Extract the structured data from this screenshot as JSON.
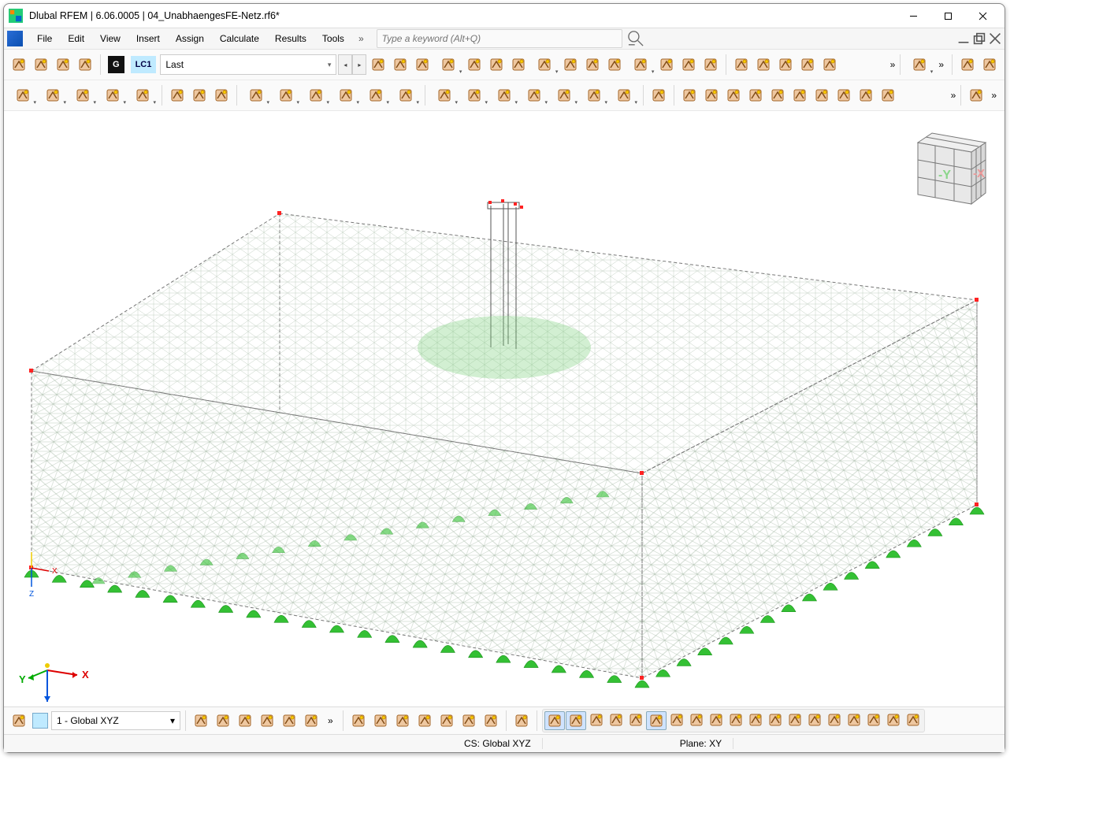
{
  "title": "Dlubal RFEM | 6.06.0005 | 04_UnabhaengesFE-Netz.rf6*",
  "menu": {
    "file": "File",
    "edit": "Edit",
    "view": "View",
    "insert": "Insert",
    "assign": "Assign",
    "calculate": "Calculate",
    "results": "Results",
    "tools": "Tools"
  },
  "search": {
    "placeholder": "Type a keyword (Alt+Q)"
  },
  "loadcase": {
    "tag_g": "G",
    "tag_lc": "LC1",
    "combo": "Last"
  },
  "coordinate_system": {
    "combo": "1 - Global XYZ"
  },
  "status": {
    "cs": "CS: Global XYZ",
    "plane": "Plane: XY"
  },
  "viewcube": {
    "x": "-X",
    "y": "-Y"
  },
  "axes": {
    "x": "X",
    "y": "Y",
    "z": "Z"
  },
  "toolbar1_icons": [
    "align-top",
    "align-bottom",
    "color-swatch-1",
    "color-swatch-2"
  ],
  "toolbar1b_icons": [
    "prev-load",
    "next-load",
    "run-solve",
    "show-deformation",
    "show-loads",
    "show-hide",
    "results-values",
    "results-format",
    "view-eye-1",
    "view-eye-2",
    "view-toggle",
    "view-eye-3",
    "section-view",
    "mesh-settings",
    "mesh-options"
  ],
  "toolbar1c_icons": [
    "new-model",
    "open-model",
    "cloud-1",
    "cloud-2",
    "snapshot"
  ],
  "toolbar1d_icons": [
    "select-arrow"
  ],
  "toolbar1e_icons": [
    "zoom-find",
    "zoom-previous"
  ],
  "toolbar2a_icons": [
    "new-node",
    "new-line",
    "new-member",
    "new-surface",
    "new-solid"
  ],
  "toolbar2b_icons": [
    "support-1",
    "support-2",
    "support-3"
  ],
  "toolbar2c_icons": [
    "load-node",
    "load-line",
    "load-area",
    "load-temp",
    "load-free",
    "load-options"
  ],
  "toolbar2d_icons": [
    "select-special",
    "grid-select",
    "select-line",
    "select-member",
    "copy-special",
    "array",
    "mirror"
  ],
  "toolbar2e_icons": [
    "dimension"
  ],
  "toolbar2f_icons": [
    "filter",
    "ortho",
    "frame-view",
    "section",
    "extrude",
    "wall",
    "cube-view",
    "grid-mesh",
    "line-mesh",
    "check"
  ],
  "toolbar2g_icons": [
    "grid-toggle"
  ],
  "bottombar_left": [
    "workplane",
    "move-wp",
    "rotate-wp",
    "offset-wp",
    "flip-wp",
    "grid-wp",
    "star-wp"
  ],
  "bottombar_mid": [
    "vis-1",
    "vis-2",
    "vis-3",
    "vis-4",
    "vis-5",
    "vis-6",
    "vis-7"
  ],
  "bottombar_snap": [
    "snap-grid",
    "snap-magnet",
    "snap-end",
    "snap-mid",
    "snap-int",
    "snap-perp",
    "snap-tan",
    "snap-par",
    "snap-circle",
    "snap-ellipse",
    "snap-cross",
    "snap-edge",
    "snap-face",
    "snap-bg",
    "snap-obj",
    "snap-layer",
    "snap-rect",
    "snap-quad",
    "snap-rot"
  ]
}
